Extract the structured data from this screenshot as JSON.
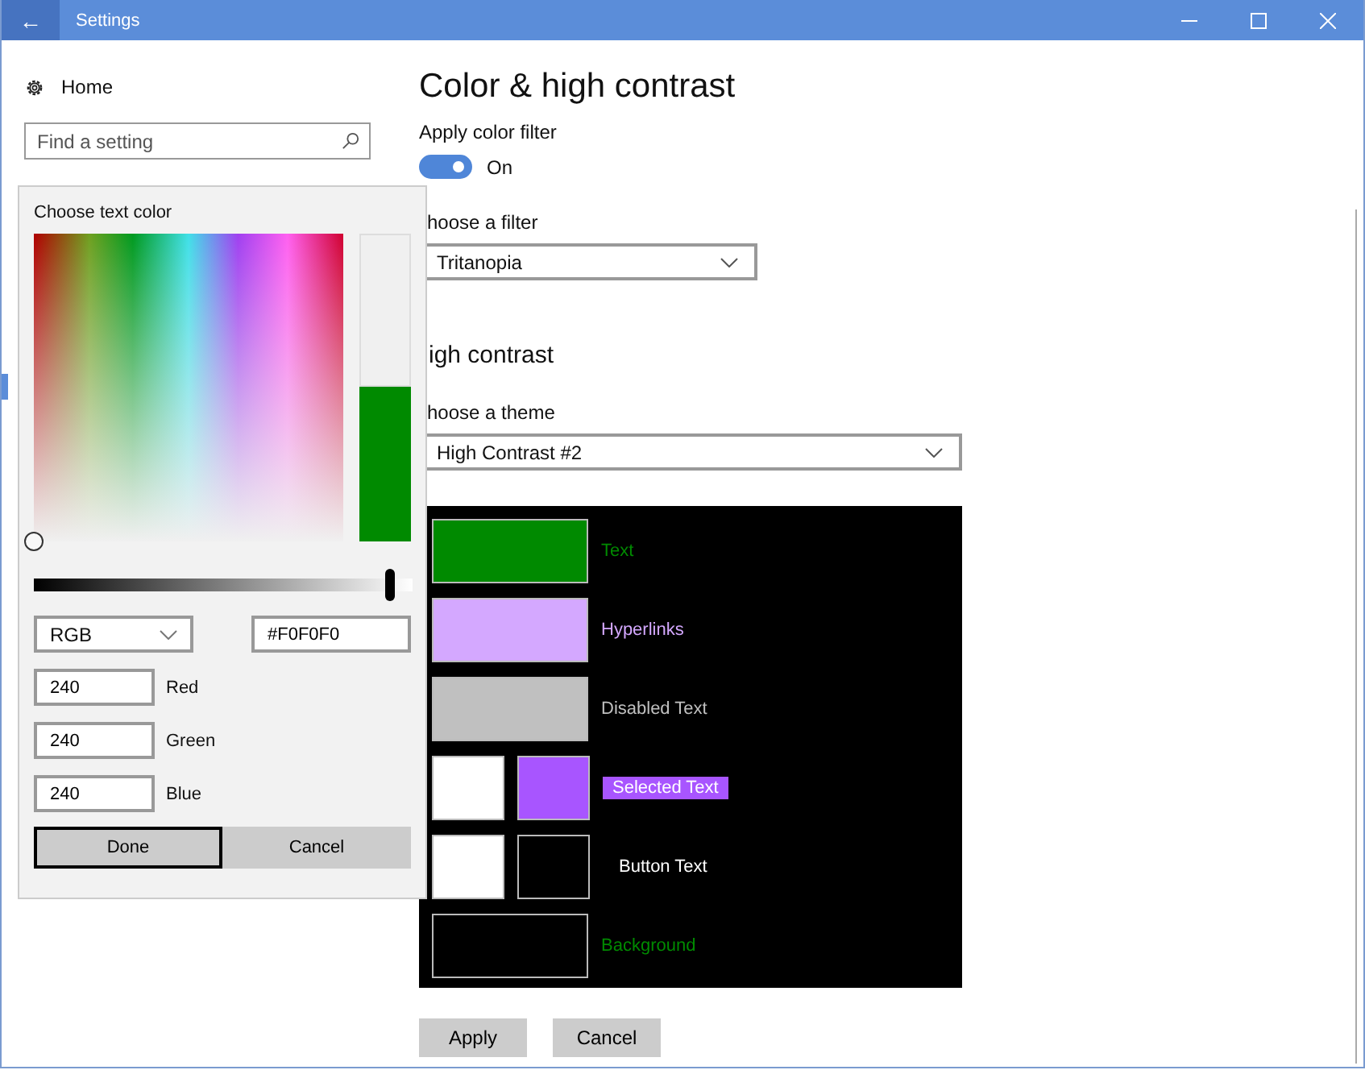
{
  "window": {
    "title": "Settings",
    "back": "←"
  },
  "sidebar": {
    "home": "Home",
    "search": {
      "placeholder": "Find a setting"
    }
  },
  "page": {
    "title": "Color & high contrast",
    "color_filter": {
      "label": "Apply color filter",
      "on": true,
      "state_text": "On"
    },
    "filter": {
      "label": "hoose a filter",
      "value": "Tritanopia"
    },
    "high_contrast": {
      "heading": "igh contrast",
      "theme_label": "hoose a theme",
      "theme": "High Contrast #2"
    },
    "preview": [
      {
        "kind": "single",
        "swatches": [
          {
            "color": "#008a00"
          }
        ],
        "label": {
          "text": "Text",
          "color": "#008a00"
        }
      },
      {
        "kind": "single",
        "swatches": [
          {
            "color": "#d4a8ff"
          }
        ],
        "label": {
          "text": "Hyperlinks",
          "color": "#d4a8ff"
        }
      },
      {
        "kind": "single",
        "swatches": [
          {
            "color": "#c0c0c0"
          }
        ],
        "label": {
          "text": "Disabled Text",
          "color": "#c0c0c0"
        }
      },
      {
        "kind": "pair",
        "swatches": [
          {
            "color": "#ffffff"
          },
          {
            "color": "#a855ff"
          }
        ],
        "label": {
          "text": "Selected Text"
        },
        "highlight": {
          "color": "#a855ff"
        }
      },
      {
        "kind": "pair",
        "swatches": [
          {
            "color": "#ffffff"
          },
          {
            "color": "#000000"
          }
        ],
        "label": {
          "text": "Button Text",
          "color": "#ffffff"
        }
      },
      {
        "kind": "single",
        "swatches": [
          {
            "color": "#000000"
          }
        ],
        "label": {
          "text": "Background",
          "color": "#008a00"
        }
      }
    ],
    "buttons": [
      "Apply",
      "Cancel"
    ]
  },
  "color_picker": {
    "title": "Choose text color",
    "comparison": [
      {
        "color": "#f0f0f0"
      },
      {
        "color": "#008a00"
      }
    ],
    "brightness": {
      "level": 0.94
    },
    "mode": "RGB",
    "hex": "#F0F0F0",
    "channels": [
      {
        "value": "240",
        "label": "Red"
      },
      {
        "value": "240",
        "label": "Green"
      },
      {
        "value": "240",
        "label": "Blue"
      }
    ],
    "buttons": [
      {
        "label": "Done",
        "focused": true
      },
      {
        "label": "Cancel",
        "focused": false
      }
    ]
  }
}
